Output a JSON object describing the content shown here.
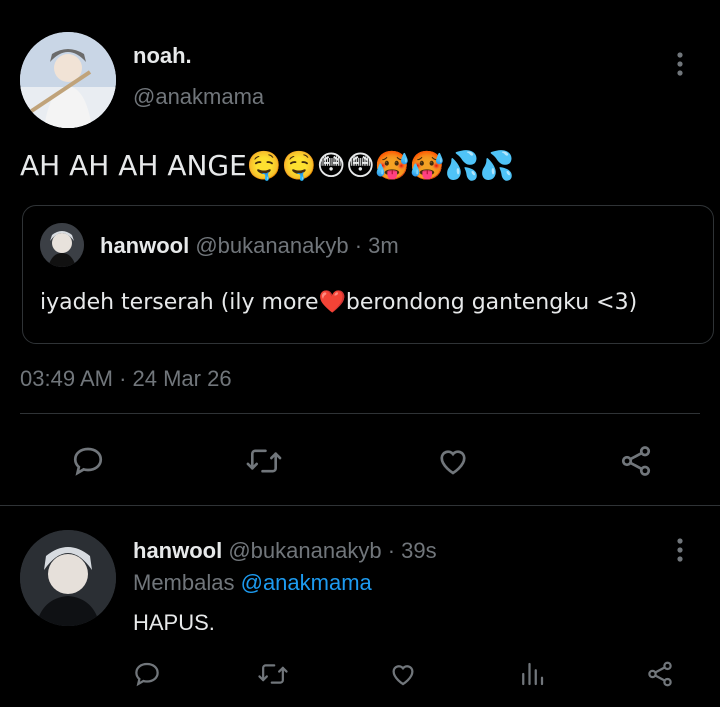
{
  "tweet": {
    "author_name": "noah.",
    "author_handle": "@anakmama",
    "text": "AH AH AH ANGE🤤🤤😳😳🥵🥵💦💦",
    "timestamp": "03:49 AM · 24 Mar 26"
  },
  "quoted": {
    "author_name": "hanwool",
    "author_handle": "@bukananakyb",
    "age": "· 3m",
    "text": "iyadeh terserah (ily more❤️berondong gantengku <3)"
  },
  "reply": {
    "author_name": "hanwool",
    "author_handle": "@bukananakyb",
    "age": "· 39s",
    "reply_prefix": "Membalas",
    "reply_to": "@anakmama",
    "text": "HAPUS."
  },
  "icons": {
    "more": "more-vertical-icon",
    "reply": "reply-icon",
    "retweet": "retweet-icon",
    "like": "like-icon",
    "share": "share-icon",
    "views": "views-icon"
  },
  "colors": {
    "background": "#000000",
    "text": "#e7e9ea",
    "muted": "#71767b",
    "link": "#1d9bf0",
    "border": "#2f3336"
  }
}
